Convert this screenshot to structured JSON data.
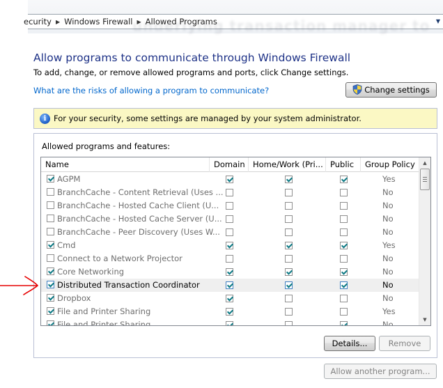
{
  "address_bar": {
    "breadcrumbs": [
      "ecurity",
      "Windows Firewall",
      "Allowed Programs"
    ],
    "ghost_text": "underlying transaction manager to"
  },
  "page": {
    "title": "Allow programs to communicate through Windows Firewall",
    "subtitle": "To add, change, or remove allowed programs and ports, click Change settings.",
    "risk_link": "What are the risks of allowing a program to communicate?",
    "change_settings_label": "Change settings"
  },
  "info_bar": {
    "icon": "info-icon",
    "text": "For your security, some settings are managed by your system administrator."
  },
  "programs": {
    "group_label": "Allowed programs and features:",
    "columns": [
      "Name",
      "Domain",
      "Home/Work (Pri...",
      "Public",
      "Group Policy"
    ],
    "rows": [
      {
        "name": "AGPM",
        "enabled": true,
        "domain": true,
        "home": true,
        "public": true,
        "group_policy": "Yes"
      },
      {
        "name": "BranchCache - Content Retrieval (Uses ...",
        "enabled": false,
        "domain": false,
        "home": false,
        "public": false,
        "group_policy": "No"
      },
      {
        "name": "BranchCache - Hosted Cache Client (U...",
        "enabled": false,
        "domain": false,
        "home": false,
        "public": false,
        "group_policy": "No"
      },
      {
        "name": "BranchCache - Hosted Cache Server (U...",
        "enabled": false,
        "domain": false,
        "home": false,
        "public": false,
        "group_policy": "No"
      },
      {
        "name": "BranchCache - Peer Discovery (Uses W...",
        "enabled": false,
        "domain": false,
        "home": false,
        "public": false,
        "group_policy": "No"
      },
      {
        "name": "Cmd",
        "enabled": true,
        "domain": true,
        "home": true,
        "public": true,
        "group_policy": "Yes"
      },
      {
        "name": "Connect to a Network Projector",
        "enabled": false,
        "domain": false,
        "home": false,
        "public": false,
        "group_policy": "No"
      },
      {
        "name": "Core Networking",
        "enabled": true,
        "domain": true,
        "home": true,
        "public": true,
        "group_policy": "No"
      },
      {
        "name": "Distributed Transaction Coordinator",
        "enabled": true,
        "domain": true,
        "home": true,
        "public": true,
        "group_policy": "No",
        "selected": true
      },
      {
        "name": "Dropbox",
        "enabled": true,
        "domain": true,
        "home": false,
        "public": false,
        "group_policy": "No"
      },
      {
        "name": "File and Printer Sharing",
        "enabled": true,
        "domain": true,
        "home": false,
        "public": false,
        "group_policy": "Yes"
      },
      {
        "name": "File and Printer Sharing",
        "enabled": true,
        "domain": true,
        "home": false,
        "public": true,
        "group_policy": "No"
      }
    ],
    "details_label": "Details...",
    "remove_label": "Remove"
  },
  "allow_another_label": "Allow another program...",
  "annotation": {
    "color": "#e60000"
  }
}
